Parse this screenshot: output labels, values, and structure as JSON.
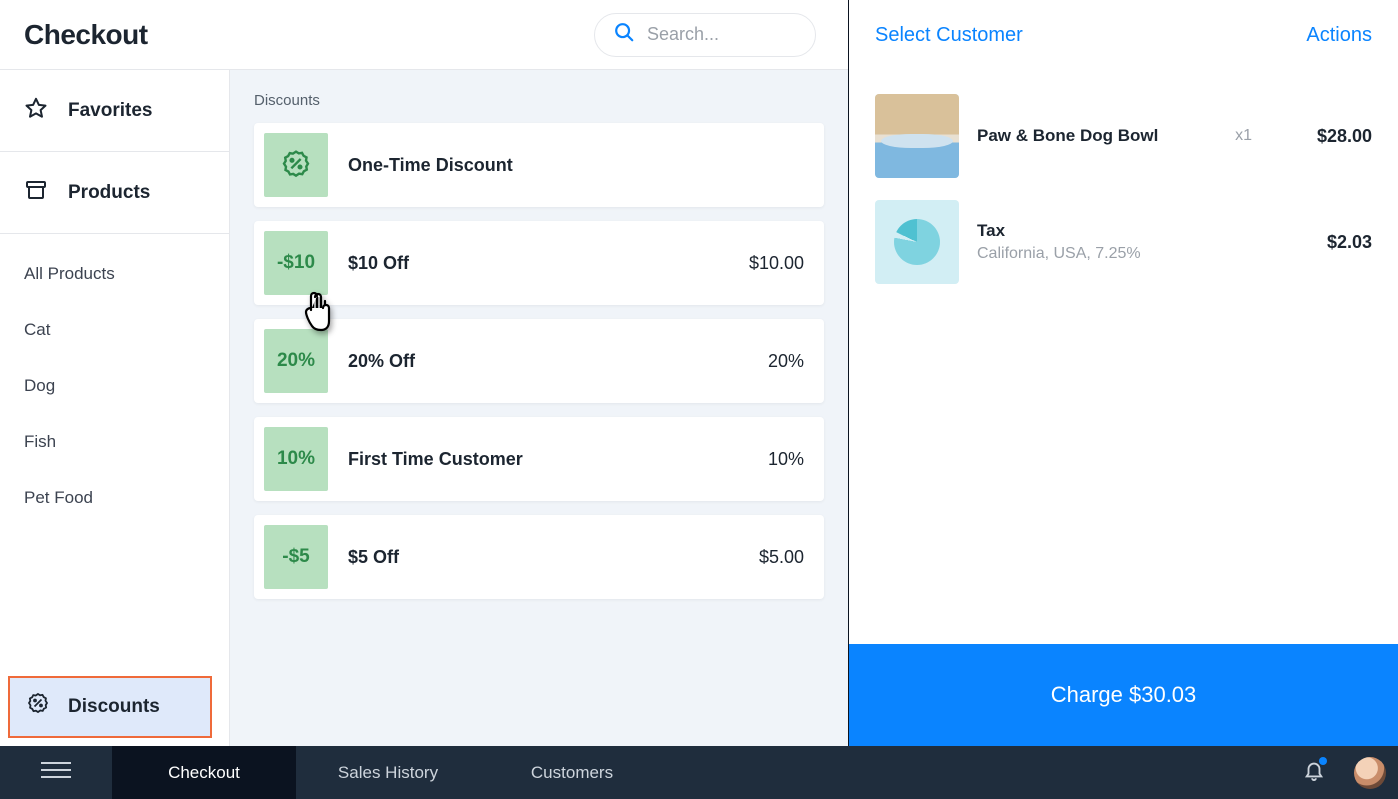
{
  "header": {
    "title": "Checkout",
    "search_placeholder": "Search..."
  },
  "cart_header": {
    "select_customer": "Select Customer",
    "actions": "Actions"
  },
  "sidebar": {
    "favorites": "Favorites",
    "products": "Products",
    "categories": [
      "All Products",
      "Cat",
      "Dog",
      "Fish",
      "Pet Food"
    ],
    "discounts": "Discounts"
  },
  "main": {
    "section_label": "Discounts",
    "discounts": [
      {
        "badge_type": "icon",
        "badge": "",
        "name": "One-Time Discount",
        "value": ""
      },
      {
        "badge_type": "text",
        "badge": "-$10",
        "name": "$10 Off",
        "value": "$10.00"
      },
      {
        "badge_type": "text",
        "badge": "20%",
        "name": "20% Off",
        "value": "20%"
      },
      {
        "badge_type": "text",
        "badge": "10%",
        "name": "First Time Customer",
        "value": "10%"
      },
      {
        "badge_type": "text",
        "badge": "-$5",
        "name": "$5 Off",
        "value": "$5.00"
      }
    ]
  },
  "cart": {
    "items": [
      {
        "name": "Paw & Bone Dog Bowl",
        "qty": "x1",
        "price": "$28.00",
        "thumb": "product"
      }
    ],
    "tax": {
      "label": "Tax",
      "detail": "California, USA, 7.25%",
      "amount": "$2.03"
    },
    "charge_label": "Charge $30.03"
  },
  "bottombar": {
    "tabs": [
      {
        "label": "Checkout",
        "active": true
      },
      {
        "label": "Sales History",
        "active": false
      },
      {
        "label": "Customers",
        "active": false
      }
    ]
  }
}
